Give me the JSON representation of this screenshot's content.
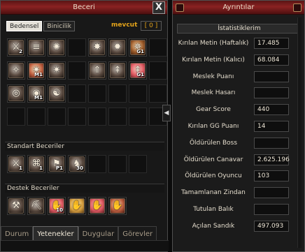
{
  "left_window": {
    "title": "Beceri",
    "close_symbol": "X",
    "subtabs": [
      "Bedensel",
      "Binicilik"
    ],
    "active_subtab": "Bedensel",
    "points_label": "mevcut",
    "points_value": "[ 0 ]",
    "skill_rows": [
      [
        {
          "icon": "sword-slash-icon",
          "glyph": "⚔",
          "level": "2",
          "style": "dark"
        },
        {
          "icon": "triple-slash-icon",
          "glyph": "≡",
          "level": "",
          "style": "dark"
        },
        {
          "icon": "whirl-slash-icon",
          "glyph": "✺",
          "level": "",
          "style": "dark"
        },
        {
          "icon": "empty-slot",
          "glyph": "",
          "level": "",
          "style": "empty"
        },
        {
          "icon": "spike-burst-icon",
          "glyph": "✸",
          "level": "",
          "style": "dark"
        },
        {
          "icon": "star-burst-icon",
          "glyph": "✹",
          "level": "",
          "style": "dark"
        },
        {
          "icon": "star-burst-grand-icon",
          "glyph": "✵",
          "level": "G1",
          "style": "brown"
        },
        {
          "icon": "empty-slot",
          "glyph": "",
          "level": "",
          "style": "empty"
        }
      ],
      [
        {
          "icon": "shield-rune-icon",
          "glyph": "✧",
          "level": "",
          "style": "dark"
        },
        {
          "icon": "sun-flare-icon",
          "glyph": "✷",
          "level": "M1",
          "style": "warm"
        },
        {
          "icon": "sun-flare-dark-icon",
          "glyph": "✷",
          "level": "",
          "style": "dark"
        },
        {
          "icon": "empty-slot",
          "glyph": "",
          "level": "",
          "style": "empty"
        },
        {
          "icon": "arrow-up-icon",
          "glyph": "⇑",
          "level": "",
          "style": "dark"
        },
        {
          "icon": "tree-totem-icon",
          "glyph": "⇞",
          "level": "",
          "style": "dark"
        },
        {
          "icon": "tree-totem-red-icon",
          "glyph": "⇞",
          "level": "G1",
          "style": "pink"
        },
        {
          "icon": "empty-slot",
          "glyph": "",
          "level": "",
          "style": "empty"
        }
      ],
      [
        {
          "icon": "spiral-icon",
          "glyph": "◎",
          "level": "",
          "style": "dark"
        },
        {
          "icon": "spiral-wave-icon",
          "glyph": "◉",
          "level": "M1",
          "style": "dark"
        },
        {
          "icon": "yin-yang-icon",
          "glyph": "☯",
          "level": "",
          "style": "dark"
        },
        {
          "icon": "empty-slot",
          "glyph": "",
          "level": "",
          "style": "empty"
        },
        {
          "icon": "empty-slot",
          "glyph": "",
          "level": "",
          "style": "empty"
        },
        {
          "icon": "empty-slot",
          "glyph": "",
          "level": "",
          "style": "empty"
        },
        {
          "icon": "empty-slot",
          "glyph": "",
          "level": "",
          "style": "empty"
        },
        {
          "icon": "empty-slot",
          "glyph": "",
          "level": "",
          "style": "empty"
        }
      ],
      [
        {
          "icon": "empty-slot",
          "glyph": "",
          "level": "",
          "style": "empty"
        },
        {
          "icon": "empty-slot",
          "glyph": "",
          "level": "",
          "style": "empty"
        },
        {
          "icon": "empty-slot",
          "glyph": "",
          "level": "",
          "style": "empty"
        },
        {
          "icon": "empty-slot",
          "glyph": "",
          "level": "",
          "style": "empty"
        },
        {
          "icon": "empty-slot",
          "glyph": "",
          "level": "",
          "style": "empty"
        },
        {
          "icon": "empty-slot",
          "glyph": "",
          "level": "",
          "style": "empty"
        },
        {
          "icon": "empty-slot",
          "glyph": "",
          "level": "",
          "style": "empty"
        },
        {
          "icon": "empty-slot",
          "glyph": "",
          "level": "",
          "style": "empty"
        }
      ]
    ],
    "standard_label": "Standart Beceriler",
    "standard_skills": [
      {
        "icon": "sword-strike-icon",
        "glyph": "⚔",
        "level": "1",
        "style": "dark"
      },
      {
        "icon": "chain-knot-icon",
        "glyph": "⌘",
        "level": "1",
        "style": "dark"
      },
      {
        "icon": "flag-icon",
        "glyph": "⚑",
        "level": "P1",
        "style": "dark"
      },
      {
        "icon": "horse-icon",
        "glyph": "♞",
        "level": "30",
        "style": "dark"
      },
      {
        "icon": "empty-slot",
        "glyph": "",
        "level": "",
        "style": "empty"
      },
      {
        "icon": "empty-slot",
        "glyph": "",
        "level": "",
        "style": "empty"
      },
      {
        "icon": "empty-slot",
        "glyph": "",
        "level": "",
        "style": "empty"
      }
    ],
    "support_label": "Destek Beceriler",
    "support_skills": [
      {
        "icon": "broom-icon",
        "glyph": "⚒",
        "level": "",
        "style": "dark"
      },
      {
        "icon": "pickaxe-icon",
        "glyph": "⛏",
        "level": "",
        "style": "dark"
      },
      {
        "icon": "hand-buff-icon",
        "glyph": "✋",
        "level": "10",
        "style": "pink"
      },
      {
        "icon": "hand-gold-icon",
        "glyph": "✋",
        "level": "",
        "style": "gold"
      },
      {
        "icon": "hand-red-icon",
        "glyph": "✋",
        "level": "",
        "style": "pink"
      },
      {
        "icon": "hand-amber-icon",
        "glyph": "✋",
        "level": "",
        "style": "warm"
      }
    ],
    "bottom_tabs": [
      "Durum",
      "Yetenekler",
      "Duygular",
      "Görevler"
    ],
    "active_bottom_tab": "Yetenekler"
  },
  "right_window": {
    "title": "Ayrıntılar",
    "section_header": "İstatistiklerim",
    "stats": [
      {
        "label": "Kırılan Metin (Haftalık)",
        "value": "17.485"
      },
      {
        "label": "Kırılan Metin (Kalıcı)",
        "value": "68.084"
      },
      {
        "label": "Meslek Puanı",
        "value": ""
      },
      {
        "label": "Meslek Hasarı",
        "value": ""
      },
      {
        "label": "Gear Score",
        "value": "440"
      },
      {
        "label": "Kırılan GG Puanı",
        "value": "14"
      },
      {
        "label": "Öldürülen Boss",
        "value": ""
      },
      {
        "label": "Öldürülen Canavar",
        "value": "2.625.196"
      },
      {
        "label": "Öldürülen Oyuncu",
        "value": "103"
      },
      {
        "label": "Tamamlanan Zindan",
        "value": ""
      },
      {
        "label": "Tutulan Balık",
        "value": ""
      },
      {
        "label": "Açılan Sandık",
        "value": "497.093"
      }
    ]
  }
}
